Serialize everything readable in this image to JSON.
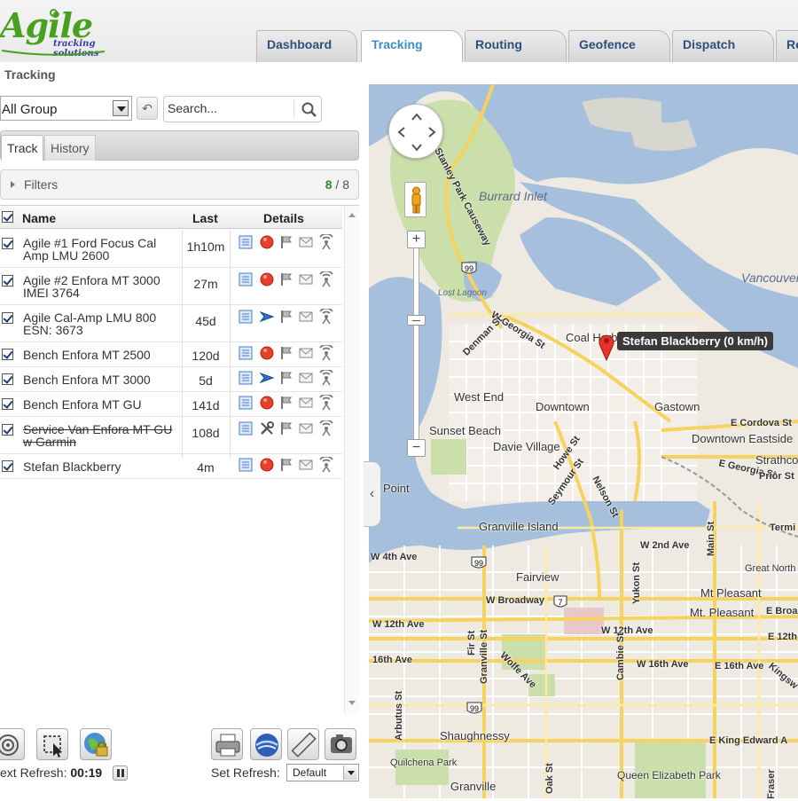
{
  "app": {
    "logo_brand": "Agile",
    "logo_tagline": "tracking solutions"
  },
  "nav_tabs": [
    {
      "label": "Dashboard",
      "active": false
    },
    {
      "label": "Tracking",
      "active": true
    },
    {
      "label": "Routing",
      "active": false
    },
    {
      "label": "Geofence",
      "active": false
    },
    {
      "label": "Dispatch",
      "active": false
    },
    {
      "label": "Re",
      "active": false
    }
  ],
  "page_title": "Tracking",
  "controls": {
    "group_value": "All Group",
    "search_placeholder": "Search..."
  },
  "subtabs": [
    {
      "label": "Track",
      "active": true
    },
    {
      "label": "History",
      "active": false
    }
  ],
  "filters": {
    "label": "Filters",
    "shown": "8",
    "total": "/ 8"
  },
  "table": {
    "headers": {
      "name": "Name",
      "last": "Last",
      "details": "Details"
    },
    "rows": [
      {
        "name": "Agile #1 Ford Focus Cal Amp LMU 2600",
        "last": "1h10m",
        "status": "stopped",
        "strike": false
      },
      {
        "name": "Agile #2 Enfora MT 3000 IMEI 3764",
        "last": "27m",
        "status": "stopped",
        "strike": false
      },
      {
        "name": "Agile Cal-Amp LMU 800 ESN: 3673",
        "last": "45d",
        "status": "moving",
        "strike": false
      },
      {
        "name": "Bench Enfora MT 2500",
        "last": "120d",
        "status": "stopped",
        "strike": false
      },
      {
        "name": "Bench Enfora MT 3000",
        "last": "5d",
        "status": "moving",
        "strike": false
      },
      {
        "name": "Bench Enfora MT GU",
        "last": "141d",
        "status": "stopped",
        "strike": false
      },
      {
        "name": "Service Van Enfora MT GU w Garmin",
        "last": "108d",
        "status": "service",
        "strike": true
      },
      {
        "name": "Stefan Blackberry",
        "last": "4m",
        "status": "stopped",
        "strike": false
      }
    ]
  },
  "footer": {
    "next_refresh_label": "ext Refresh:",
    "next_refresh_value": "00:19",
    "set_refresh_label": "Set Refresh:",
    "set_refresh_value": "Default"
  },
  "map": {
    "marker_label": "Stefan Blackberry (0 km/h)",
    "water_labels": [
      "Burrard Inlet",
      "Vancouver Harbour",
      "Lost Lagoon"
    ],
    "place_labels": [
      "Coal Harbour",
      "West End",
      "Downtown",
      "Gastown",
      "Sunset Beach",
      "Davie Village",
      "Downtown Eastside",
      "Strathcona",
      "Point",
      "Granville Island",
      "Fairview",
      "Mt Pleasant",
      "Mt. Pleasant",
      "Shaughnessy",
      "Queen Elizabeth Park",
      "Quilchena Park",
      "Granville",
      "Great North"
    ],
    "street_labels": [
      "Stanley Park Causeway",
      "W Georgia St",
      "Denman St",
      "Howe St",
      "Seymour St",
      "Nelson St",
      "E Cordova St",
      "E Georgia St",
      "Prior St",
      "Termi",
      "W 4th Ave",
      "W 2nd Ave",
      "W Broadway",
      "E Broa",
      "W 12th Ave",
      "W 12th Ave",
      "E 12th A",
      "16th Ave",
      "W 16th Ave",
      "E 16th Ave",
      "Kingsw",
      "Arbutus St",
      "Fir St",
      "Granville St",
      "Oak St",
      "Wolfe Ave",
      "Cambie St",
      "Yukon St",
      "Main St",
      "Fraser",
      "E King Edward A"
    ],
    "shields": [
      "99",
      "99",
      "99",
      "7"
    ]
  },
  "colors": {
    "brand_green": "#48a11e",
    "tab_active_text": "#3d8ecb",
    "water": "#a5bfdd",
    "park": "#cadfaa",
    "road_major": "#fde891"
  }
}
